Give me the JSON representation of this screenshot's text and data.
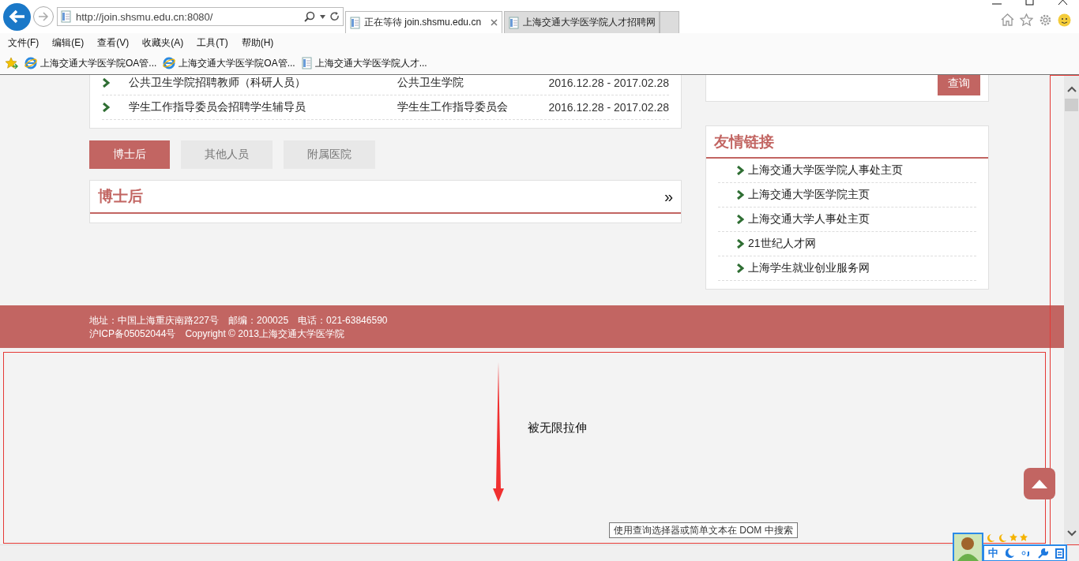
{
  "browser": {
    "address": "http://join.shsmu.edu.cn:8080/",
    "tabs": [
      {
        "label": "正在等待 join.shsmu.edu.cn",
        "selected": true
      },
      {
        "label": "上海交通大学医学院人才招聘网",
        "selected": false
      }
    ],
    "menu": [
      "文件(F)",
      "编辑(E)",
      "查看(V)",
      "收藏夹(A)",
      "工具(T)",
      "帮助(H)"
    ],
    "favorites": [
      {
        "label": "上海交通大学医学院OA管...",
        "kind": "ie"
      },
      {
        "label": "上海交通大学医学院OA管...",
        "kind": "ie"
      },
      {
        "label": "上海交通大学医学院人才...",
        "kind": "page"
      }
    ]
  },
  "jobs": [
    {
      "title": "公共卫生学院招聘教师（科研人员）",
      "department": "公共卫生学院",
      "period": "2016.12.28 - 2017.02.28"
    },
    {
      "title": "学生工作指导委员会招聘学生辅导员",
      "department": "学生生工作指导委员会",
      "period": "2016.12.28 - 2017.02.28"
    }
  ],
  "search_button": "查询",
  "category_tabs": [
    {
      "label": "博士后",
      "selected": true
    },
    {
      "label": "其他人员",
      "selected": false
    },
    {
      "label": "附属医院",
      "selected": false
    }
  ],
  "panel": {
    "title": "博士后",
    "more": "»"
  },
  "links": {
    "title": "友情链接",
    "items": [
      "上海交通大学医学院人事处主页",
      "上海交通大学医学院主页",
      "上海交通大学人事处主页",
      "21世纪人才网",
      "上海学生就业创业服务网"
    ]
  },
  "footer": {
    "lines": [
      [
        "地址：中国上海重庆南路227号",
        "邮编：200025",
        "电话：021-63846590"
      ],
      [
        "沪ICP备05052044号",
        "Copyright © 2013上海交通大学医学院"
      ]
    ]
  },
  "overlay": {
    "note": "被无限拉伸",
    "tooltip": "使用查询选择器或简单文本在 DOM 中搜索"
  },
  "ime": {
    "mode": "中"
  }
}
